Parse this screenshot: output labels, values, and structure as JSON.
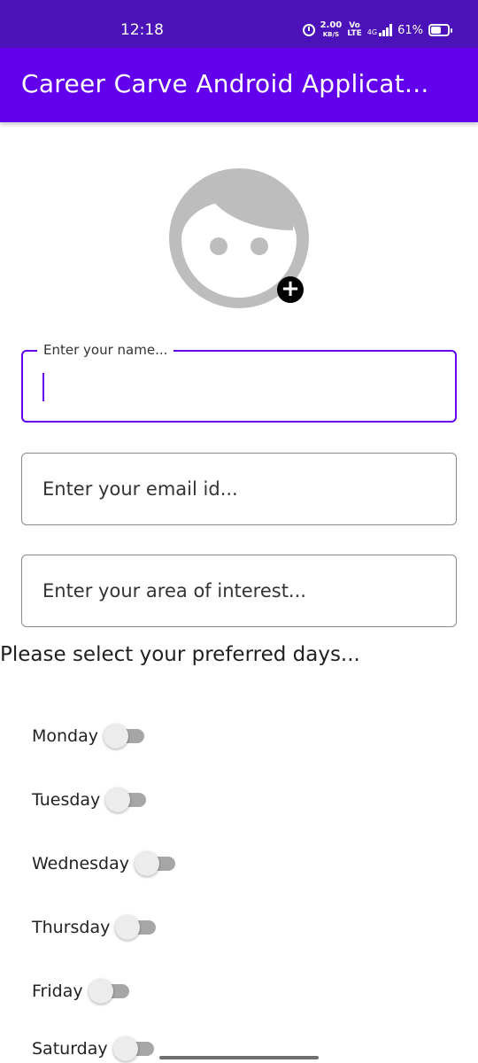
{
  "status_bar": {
    "time": "12:18",
    "net_speed": "2.00",
    "net_unit": "KB/S",
    "volte_top": "Vo",
    "volte_bottom": "LTE",
    "network": "4G",
    "battery": "61%",
    "icons": [
      "alarm-icon",
      "signal-icon",
      "battery-icon"
    ]
  },
  "app_bar": {
    "title": "Career Carve Android Applicat...",
    "color": "#6200ee"
  },
  "avatar": {
    "icon": "person-avatar-icon",
    "add_icon": "plus-circle-icon",
    "add_glyph": "+"
  },
  "form": {
    "name_label": "Enter your name...",
    "email_placeholder": "Enter your email id...",
    "interest_placeholder": "Enter your area of interest..."
  },
  "days": {
    "heading": "Please select your preferred days...",
    "items": [
      {
        "label": "Monday",
        "on": false
      },
      {
        "label": "Tuesday",
        "on": false
      },
      {
        "label": "Wednesday",
        "on": false
      },
      {
        "label": "Thursday",
        "on": false
      },
      {
        "label": "Friday",
        "on": false
      },
      {
        "label": "Saturday",
        "on": false
      }
    ]
  },
  "colors": {
    "status_bar": "#4a12b8",
    "accent": "#6200ee"
  }
}
